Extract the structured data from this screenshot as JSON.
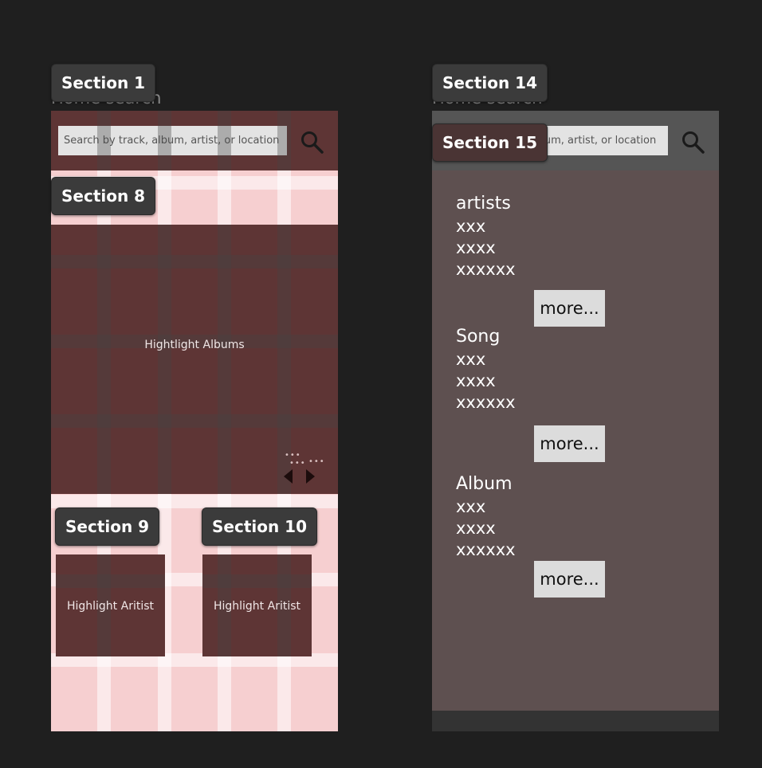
{
  "frames": {
    "left": {
      "title": "Home search",
      "search": {
        "placeholder": "Search by track, album, artist, or location",
        "value": ""
      },
      "highlight_albums_label": "Hightlight Albums",
      "highlight_artist_1_label": "Highlight Aritist",
      "highlight_artist_2_label": "Highlight Aritist"
    },
    "right": {
      "title": "Home search",
      "search": {
        "visible_text": "lbum, artist, or location"
      },
      "groups": [
        {
          "heading": "artists",
          "items": [
            "xxx",
            "xxxx",
            "xxxxxx"
          ],
          "more_label": "more..."
        },
        {
          "heading": "Song",
          "items": [
            "xxx",
            "xxxx",
            "xxxxxx"
          ],
          "more_label": "more..."
        },
        {
          "heading": "Album",
          "items": [
            "xxx",
            "xxxx",
            "xxxxxx"
          ],
          "more_label": "more..."
        }
      ]
    }
  },
  "sections": {
    "s1": "Section 1",
    "s8": "Section 8",
    "s9": "Section 9",
    "s10": "Section 10",
    "s14": "Section 14",
    "s15": "Section 15"
  },
  "icons": {
    "search": "search-icon",
    "prev": "prev-arrow-icon",
    "next": "next-arrow-icon",
    "dots": "more-dots-icon"
  },
  "colors": {
    "canvas": "#1f1f1f",
    "layout_grid": "#f6cfd0",
    "section_fill": "#5e3535",
    "results_fill": "#5e5050",
    "badge": "#3b3b3b",
    "more_button": "#dcdcdc"
  }
}
